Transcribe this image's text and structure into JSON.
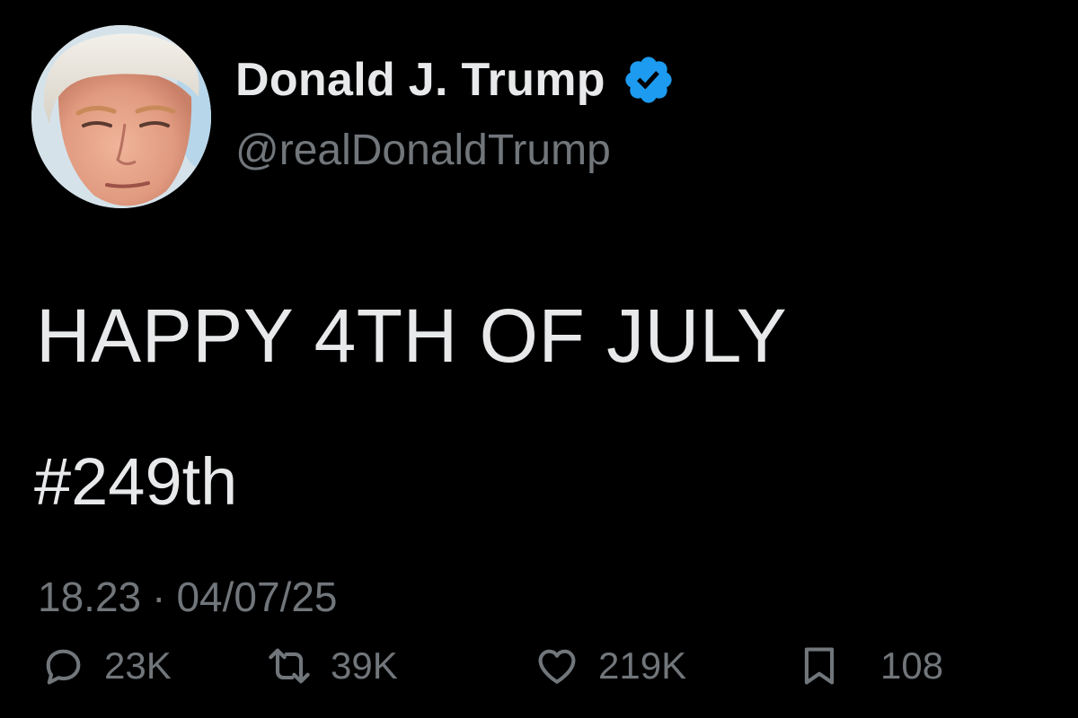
{
  "author": {
    "display_name": "Donald J. Trump",
    "handle": "@realDonaldTrump",
    "verified": true,
    "verified_color": "#1d9bf0",
    "avatar_icon": "profile-photo"
  },
  "post": {
    "text": "HAPPY 4TH OF JULY",
    "hashtag": "#249th"
  },
  "meta": {
    "time": "18.23",
    "separator": "·",
    "date": "04/07/25"
  },
  "actions": {
    "reply": {
      "icon": "comment-icon",
      "count": "23K"
    },
    "repost": {
      "icon": "repost-icon",
      "count": "39K"
    },
    "like": {
      "icon": "heart-icon",
      "count": "219K"
    },
    "bookmark": {
      "icon": "bookmark-icon",
      "count": "108"
    }
  },
  "colors": {
    "background": "#000000",
    "primary_text": "#e7e9ea",
    "secondary_text": "#71767b"
  }
}
